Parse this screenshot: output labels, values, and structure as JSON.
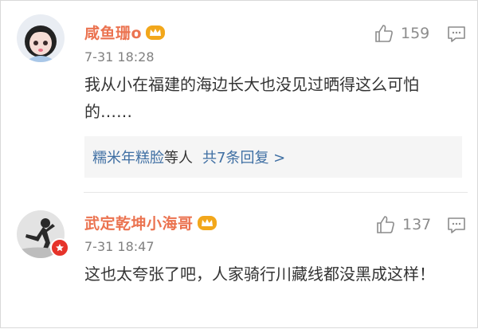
{
  "comments": [
    {
      "username": "咸鱼珊o",
      "timestamp": "7-31 18:28",
      "likes": "159",
      "text": "我从小在福建的海边长大也没见过晒得这么可怕的……",
      "replies": {
        "names_link": "糯米年糕脸",
        "names_suffix": "等人",
        "count_link": "共7条回复 >"
      }
    },
    {
      "username": "武定乾坤小海哥",
      "timestamp": "7-31 18:47",
      "likes": "137",
      "text": "这也太夸张了吧，人家骑行川藏线都没黑成这样！"
    }
  ],
  "colors": {
    "username": "#eb7350",
    "link": "#3f6fa3",
    "timestamp": "#808080",
    "crown": "#f2a71b",
    "badge": "#e6332a"
  },
  "icons": [
    "crown-icon",
    "thumbs-up-icon",
    "comment-icon",
    "verified-badge-icon"
  ]
}
